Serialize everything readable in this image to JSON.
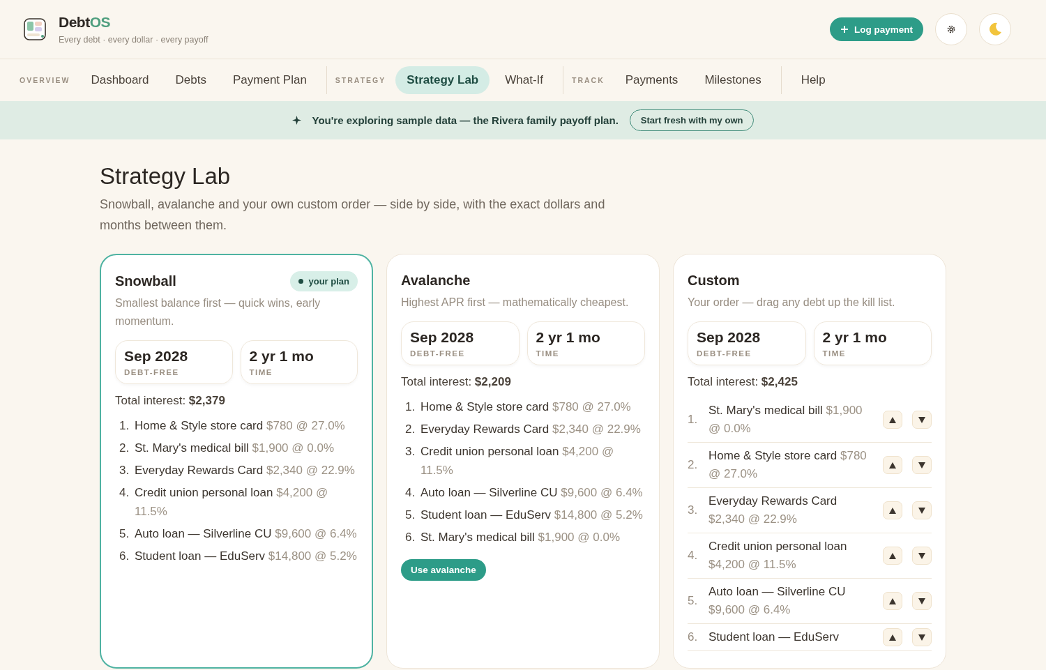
{
  "brand": {
    "name_dark": "Debt",
    "name_accent": "OS",
    "tagline": "Every debt · every dollar · every payoff"
  },
  "header_actions": {
    "primary": "Log payment"
  },
  "nav": [
    {
      "label": "OVERVIEW",
      "items": [
        {
          "label": "Dashboard",
          "selected": false
        },
        {
          "label": "Debts",
          "selected": false
        },
        {
          "label": "Payment Plan",
          "selected": false
        }
      ]
    },
    {
      "label": "STRATEGY",
      "items": [
        {
          "label": "Strategy Lab",
          "selected": true
        },
        {
          "label": "What-If",
          "selected": false
        }
      ]
    },
    {
      "label": "TRACK",
      "items": [
        {
          "label": "Payments",
          "selected": false
        },
        {
          "label": "Milestones",
          "selected": false
        }
      ]
    },
    {
      "items": [
        {
          "label": "Help",
          "selected": false
        }
      ]
    }
  ],
  "banner": {
    "text": "You're exploring sample data — the Rivera family payoff plan.",
    "action": "Start fresh with my own"
  },
  "page": {
    "title": "Strategy Lab",
    "subtitle": "Snowball, avalanche and your own custom order — side by side, with the exact dollars and months between them."
  },
  "strategies": [
    {
      "kind": "list",
      "name": "Snowball",
      "selected": true,
      "badge": "your plan",
      "description": "Smallest balance first — quick wins, early momentum.",
      "stats": [
        {
          "value": "Sep 2028",
          "label": "DEBT-FREE"
        },
        {
          "value": "2 yr 1 mo",
          "label": "TIME"
        }
      ],
      "interest_label": "Total interest:",
      "interest": "$2,379",
      "debts": [
        {
          "num": "1.",
          "name": "Home & Style store card",
          "detail": "$780 @ 27.0%"
        },
        {
          "num": "2.",
          "name": "St. Mary's medical bill",
          "detail": "$1,900 @ 0.0%"
        },
        {
          "num": "3.",
          "name": "Everyday Rewards Card",
          "detail": "$2,340 @ 22.9%"
        },
        {
          "num": "4.",
          "name": "Credit union personal loan",
          "detail": "$4,200 @ 11.5%"
        },
        {
          "num": "5.",
          "name": "Auto loan — Silverline CU",
          "detail": "$9,600 @ 6.4%"
        },
        {
          "num": "6.",
          "name": "Student loan — EduServ",
          "detail": "$14,800 @ 5.2%"
        }
      ]
    },
    {
      "kind": "list",
      "name": "Avalanche",
      "selected": false,
      "description": "Highest APR first — mathematically cheapest.",
      "stats": [
        {
          "value": "Sep 2028",
          "label": "DEBT-FREE"
        },
        {
          "value": "2 yr 1 mo",
          "label": "TIME"
        }
      ],
      "interest_label": "Total interest:",
      "interest": "$2,209",
      "debts": [
        {
          "num": "1.",
          "name": "Home & Style store card",
          "detail": "$780 @ 27.0%"
        },
        {
          "num": "2.",
          "name": "Everyday Rewards Card",
          "detail": "$2,340 @ 22.9%"
        },
        {
          "num": "3.",
          "name": "Credit union personal loan",
          "detail": "$4,200 @ 11.5%"
        },
        {
          "num": "4.",
          "name": "Auto loan — Silverline CU",
          "detail": "$9,600 @ 6.4%"
        },
        {
          "num": "5.",
          "name": "Student loan — EduServ",
          "detail": "$14,800 @ 5.2%"
        },
        {
          "num": "6.",
          "name": "St. Mary's medical bill",
          "detail": "$1,900 @ 0.0%"
        }
      ],
      "action": "Use avalanche"
    },
    {
      "kind": "reorder",
      "name": "Custom",
      "selected": false,
      "description": "Your order — drag any debt up the kill list.",
      "stats": [
        {
          "value": "Sep 2028",
          "label": "DEBT-FREE"
        },
        {
          "value": "2 yr 1 mo",
          "label": "TIME"
        }
      ],
      "interest_label": "Total interest:",
      "interest": "$2,425",
      "debts": [
        {
          "num": "1.",
          "name": "St. Mary's medical bill",
          "detail": "$1,900 @ 0.0%"
        },
        {
          "num": "2.",
          "name": "Home & Style store card",
          "detail": "$780 @ 27.0%"
        },
        {
          "num": "3.",
          "name": "Everyday Rewards Card",
          "detail": "$2,340 @ 22.9%"
        },
        {
          "num": "4.",
          "name": "Credit union personal loan",
          "detail": "$4,200 @ 11.5%"
        },
        {
          "num": "5.",
          "name": "Auto loan — Silverline CU",
          "detail": "$9,600 @ 6.4%"
        },
        {
          "num": "6.",
          "name": "Student loan — EduServ"
        }
      ]
    }
  ]
}
